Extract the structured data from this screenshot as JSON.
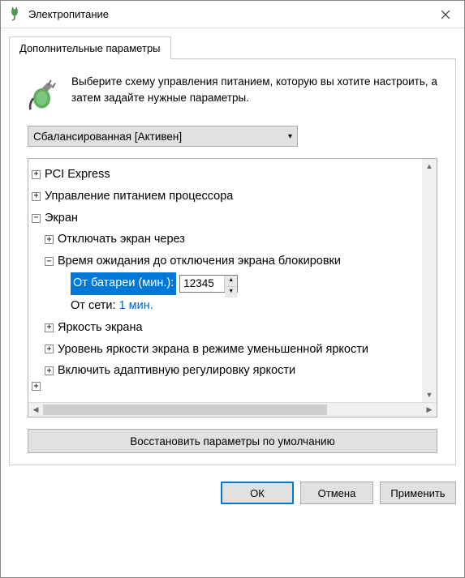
{
  "window": {
    "title": "Электропитание"
  },
  "tab": {
    "label": "Дополнительные параметры"
  },
  "intro": {
    "text": "Выберите схему управления питанием, которую вы хотите настроить, а затем задайте нужные параметры."
  },
  "scheme": {
    "selected": "Сбалансированная [Активен]"
  },
  "tree": {
    "n0": {
      "label": "PCI Express"
    },
    "n1": {
      "label": "Управление питанием процессора"
    },
    "n2": {
      "label": "Экран"
    },
    "n2_0": {
      "label": "Отключать экран через"
    },
    "n2_1": {
      "label": "Время ожидания до отключения экрана блокировки"
    },
    "n2_1_0": {
      "label": "От батареи (мин.):",
      "value": "12345"
    },
    "n2_1_1": {
      "label": "От сети:",
      "value": "1 мин."
    },
    "n2_2": {
      "label": "Яркость экрана"
    },
    "n2_3": {
      "label": "Уровень яркости экрана в режиме уменьшенной яркости"
    },
    "n2_4": {
      "label": "Включить адаптивную регулировку яркости"
    }
  },
  "buttons": {
    "restore": "Восстановить параметры по умолчанию",
    "ok": "ОК",
    "cancel": "Отмена",
    "apply": "Применить"
  }
}
